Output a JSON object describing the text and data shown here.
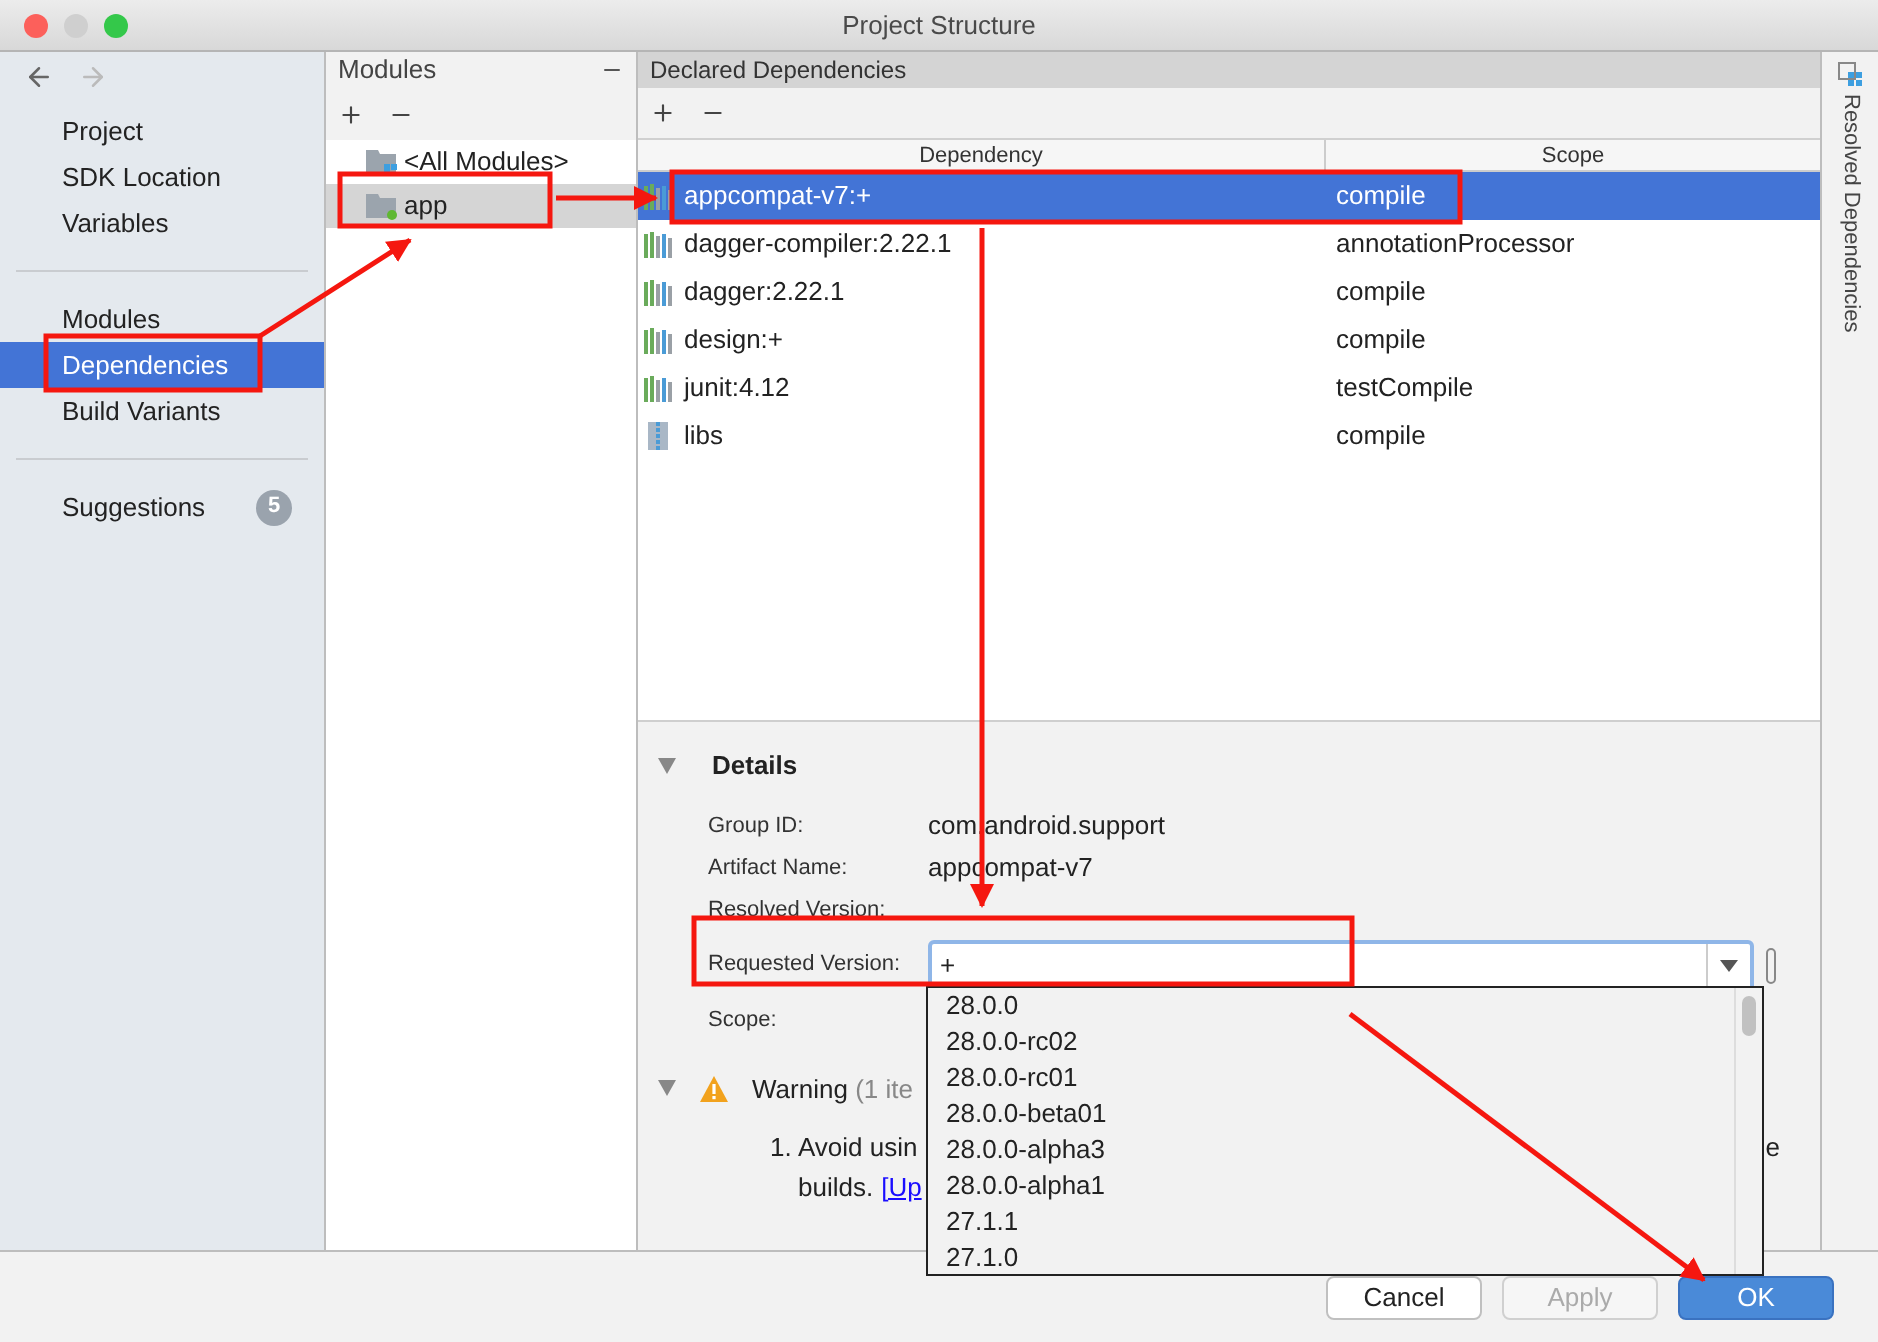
{
  "window": {
    "title": "Project Structure"
  },
  "sidebar": {
    "groups": [
      [
        {
          "label": "Project",
          "selected": false
        },
        {
          "label": "SDK Location",
          "selected": false
        },
        {
          "label": "Variables",
          "selected": false
        }
      ],
      [
        {
          "label": "Modules",
          "selected": false
        },
        {
          "label": "Dependencies",
          "selected": true
        },
        {
          "label": "Build Variants",
          "selected": false
        }
      ],
      [
        {
          "label": "Suggestions",
          "selected": false,
          "badge": "5"
        }
      ]
    ]
  },
  "modules": {
    "title": "Modules",
    "items": [
      {
        "label": "<All Modules>",
        "kind": "all",
        "selected": false
      },
      {
        "label": "app",
        "kind": "module",
        "selected": true
      }
    ]
  },
  "dependencies": {
    "title": "Declared Dependencies",
    "columns": [
      "Dependency",
      "Scope"
    ],
    "rows": [
      {
        "name": "appcompat-v7:+",
        "scope": "compile",
        "kind": "library",
        "selected": true
      },
      {
        "name": "dagger-compiler:2.22.1",
        "scope": "annotationProcessor",
        "kind": "library",
        "selected": false
      },
      {
        "name": "dagger:2.22.1",
        "scope": "compile",
        "kind": "library",
        "selected": false
      },
      {
        "name": "design:+",
        "scope": "compile",
        "kind": "library",
        "selected": false
      },
      {
        "name": "junit:4.12",
        "scope": "testCompile",
        "kind": "library",
        "selected": false
      },
      {
        "name": "libs",
        "scope": "compile",
        "kind": "jars",
        "selected": false
      }
    ]
  },
  "side_tab": "Resolved Dependencies",
  "details": {
    "title": "Details",
    "expanded": true,
    "fields": [
      {
        "label": "Group ID:",
        "value": "com.android.support"
      },
      {
        "label": "Artifact Name:",
        "value": "appcompat-v7"
      },
      {
        "label": "Resolved Version:"
      },
      {
        "label": "Requested Version:",
        "input": "+"
      },
      {
        "label": "Scope:"
      }
    ]
  },
  "warning": {
    "title": "Warning",
    "count": "(1 ite",
    "number": "1.",
    "line1": "Avoid usin",
    "line1_end": "e",
    "line2": "builds.",
    "link": "[Up"
  },
  "version_dropdown": [
    "28.0.0",
    "28.0.0-rc02",
    "28.0.0-rc01",
    "28.0.0-beta01",
    "28.0.0-alpha3",
    "28.0.0-alpha1",
    "27.1.1",
    "27.1.0"
  ],
  "buttons": [
    {
      "label": "Cancel",
      "kind": "normal"
    },
    {
      "label": "Apply",
      "kind": "disabled"
    },
    {
      "label": "OK",
      "kind": "default"
    }
  ]
}
